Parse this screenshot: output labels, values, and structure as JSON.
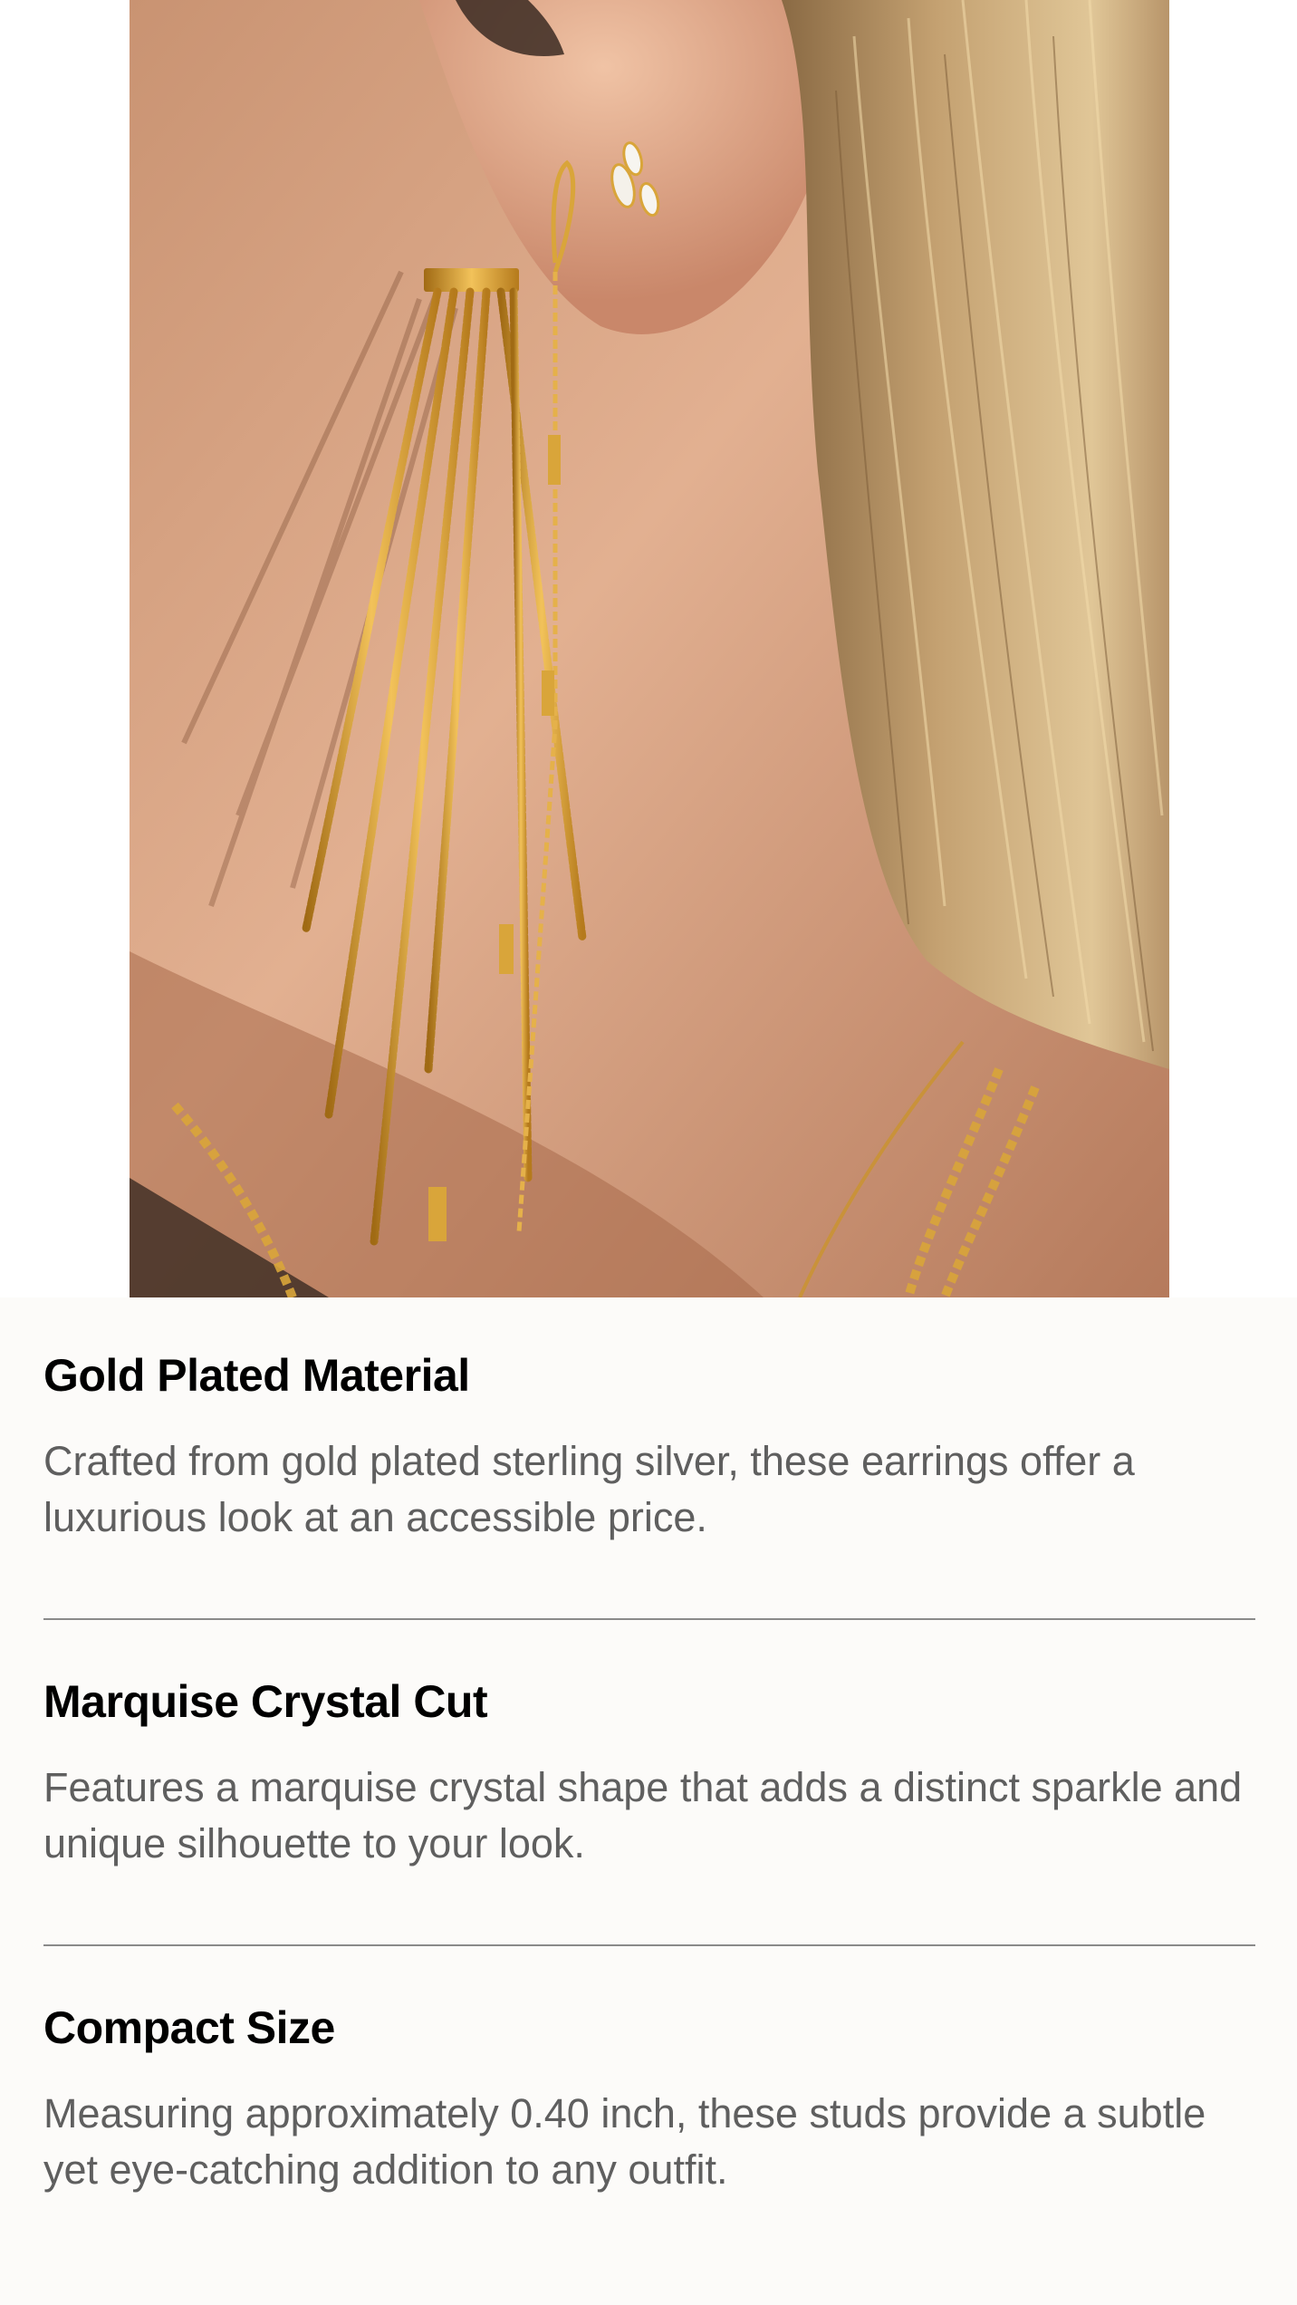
{
  "hero_image": {
    "icon": "earring-photo",
    "description_hidden": true
  },
  "features": [
    {
      "title": "Gold Plated Material",
      "text": "Crafted from gold plated sterling silver, these earrings offer a luxurious look at an accessible price."
    },
    {
      "title": "Marquise Crystal Cut",
      "text": "Features a marquise crystal shape that adds a distinct sparkle and unique silhouette to your look."
    },
    {
      "title": "Compact Size",
      "text": "Measuring approximately 0.40 inch, these studs provide a subtle yet eye-catching addition to any outfit."
    }
  ],
  "colors": {
    "background": "#fcfbf9",
    "title": "#000000",
    "body_text": "#5f5f5f",
    "divider": "#8a8a8a",
    "gold": "#d9a53a"
  }
}
